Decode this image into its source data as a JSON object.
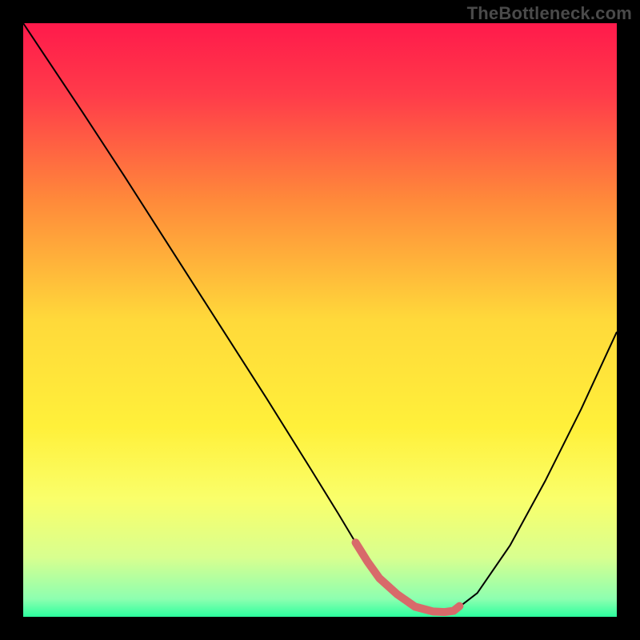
{
  "watermark": "TheBottleneck.com",
  "chart_data": {
    "type": "line",
    "title": "",
    "xlabel": "",
    "ylabel": "",
    "xlim": [
      0,
      100
    ],
    "ylim": [
      0,
      100
    ],
    "background_gradient": {
      "stops": [
        {
          "offset": 0.0,
          "color": "#ff1a4b"
        },
        {
          "offset": 0.12,
          "color": "#ff3b4a"
        },
        {
          "offset": 0.3,
          "color": "#ff8a3a"
        },
        {
          "offset": 0.5,
          "color": "#ffd93a"
        },
        {
          "offset": 0.68,
          "color": "#fff03a"
        },
        {
          "offset": 0.8,
          "color": "#faff6a"
        },
        {
          "offset": 0.9,
          "color": "#d8ff8f"
        },
        {
          "offset": 0.97,
          "color": "#8dffb0"
        },
        {
          "offset": 1.0,
          "color": "#2cff9e"
        }
      ]
    },
    "series": [
      {
        "name": "bottleneck-curve",
        "color": "#000000",
        "stroke_width": 2,
        "x": [
          0.0,
          4.0,
          10.0,
          17.0,
          25.0,
          33.0,
          41.0,
          48.5,
          53.0,
          56.0,
          60.0,
          66.0,
          70.0,
          73.0,
          76.5,
          82.0,
          88.0,
          94.0,
          100.0
        ],
        "y": [
          100.0,
          94.0,
          85.0,
          74.3,
          61.8,
          49.3,
          36.8,
          24.8,
          17.5,
          12.5,
          6.5,
          1.7,
          0.8,
          1.3,
          4.0,
          12.0,
          23.0,
          35.0,
          48.0
        ]
      }
    ],
    "markers": [
      {
        "name": "optimal-zone",
        "color": "#d86a6a",
        "stroke_width": 10,
        "linecap": "round",
        "x": [
          56.0,
          58.0,
          60.0,
          63.0,
          66.0,
          69.0,
          71.0,
          72.5,
          73.5
        ],
        "y": [
          12.5,
          9.3,
          6.5,
          3.8,
          1.7,
          0.9,
          0.8,
          1.0,
          1.8
        ]
      }
    ]
  }
}
